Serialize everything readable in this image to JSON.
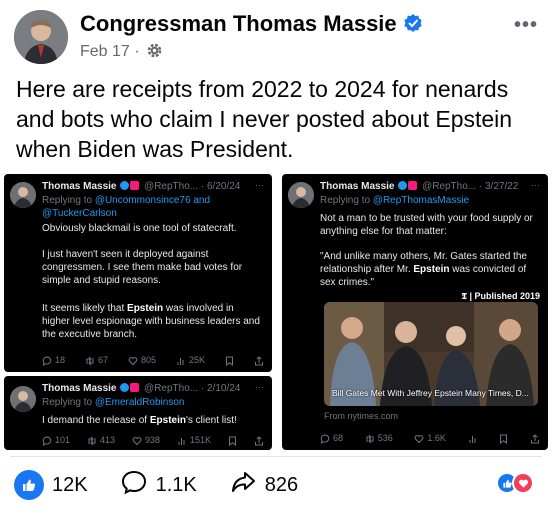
{
  "post": {
    "author": "Congressman Thomas Massie",
    "date": "Feb 17",
    "separator": "·",
    "more_label": "•••",
    "caption": "Here are receipts from 2022 to 2024 for nenards and bots who claim I never posted about Epstein when Biden was President."
  },
  "tweets": [
    {
      "name": "Thomas Massie",
      "handle": "@RepTho...",
      "date": "· 6/20/24",
      "replying_prefix": "Replying to ",
      "replying_to": "@Uncommonsince76 and @TuckerCarlson",
      "para1": "Obviously blackmail is one tool of statecraft.",
      "para2": "I just haven't seen it deployed against congressmen. I see them make bad votes for simple and stupid reasons.",
      "para3_pre": "It seems likely that ",
      "para3_bold": "Epstein",
      "para3_post": " was involved in higher level espionage with business leaders and the executive branch.",
      "replies": "18",
      "retweets": "67",
      "likes": "805",
      "views": "25K"
    },
    {
      "name": "Thomas Massie",
      "handle": "@RepTho...",
      "date": "· 2/10/24",
      "replying_prefix": "Replying to ",
      "replying_to": "@EmeraldRobinson",
      "text_pre": "I demand the release of ",
      "text_bold": "Epstein",
      "text_post": "'s client list!",
      "replies": "101",
      "retweets": "413",
      "likes": "938",
      "views": "151K"
    },
    {
      "name": "Thomas Massie",
      "handle": "@RepTho...",
      "date": "· 3/27/22",
      "replying_prefix": "Replying to ",
      "replying_to": "@RepThomasMassie",
      "para1": "Not a man to be trusted with your food supply or anything else for that matter:",
      "para2_pre": "\"And unlike many others, Mr. Gates started the relationship after Mr. ",
      "para2_bold": "Epstein",
      "para2_post": " was convicted of sex crimes.\"",
      "badge": "Published 2019",
      "photo_caption": "Bill Gates Met With Jeffrey Epstein Many Times, D...",
      "from": "From nytimes.com",
      "replies": "68",
      "retweets": "536",
      "likes": "1.6K"
    }
  ],
  "reactions": {
    "likes": "12K",
    "comments": "1.1K",
    "shares": "826"
  },
  "colors": {
    "facebook_blue": "#1877f2",
    "twitter_blue": "#1d9bf0",
    "love_red": "#f33e58"
  }
}
